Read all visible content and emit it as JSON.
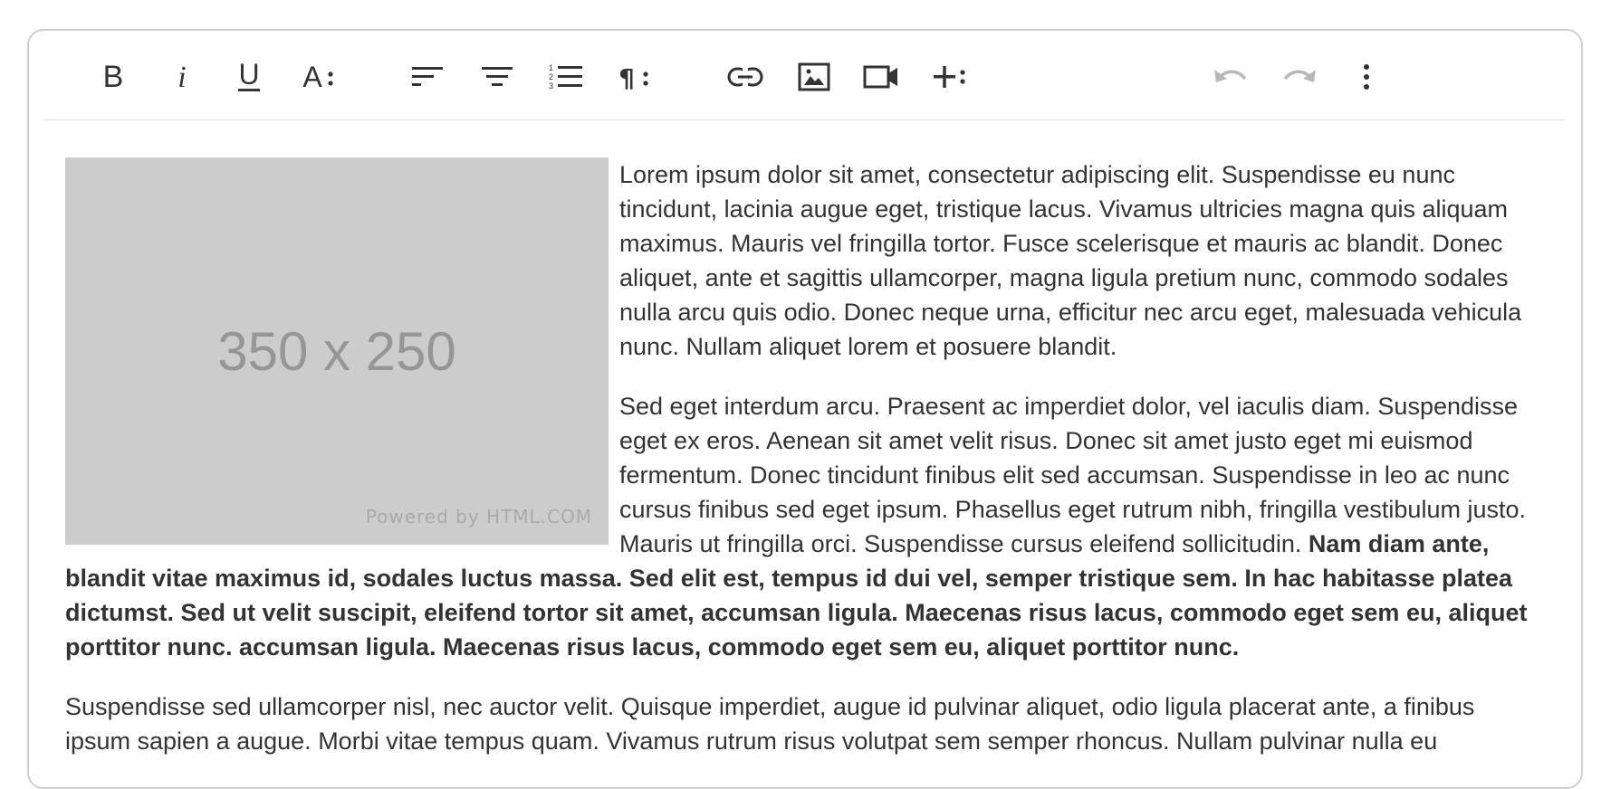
{
  "toolbar": {
    "groups": [
      {
        "name": "text-format",
        "items": [
          "bold",
          "italic",
          "underline",
          "text-style-more"
        ]
      },
      {
        "name": "paragraph-format",
        "items": [
          "align-left",
          "align-center",
          "ordered-list",
          "paragraph-more"
        ]
      },
      {
        "name": "insert",
        "items": [
          "link",
          "image",
          "video",
          "insert-more"
        ]
      },
      {
        "name": "history",
        "items": [
          "undo",
          "redo",
          "more-options"
        ]
      }
    ],
    "undo_enabled": false,
    "redo_enabled": false,
    "colors": {
      "icon": "#333333",
      "icon_disabled": "#b8b8b8"
    }
  },
  "image": {
    "label": "350 x 250",
    "powered_by": "Powered by HTML.COM",
    "background": "#cccccc"
  },
  "content": {
    "paragraph1": "Lorem ipsum dolor sit amet, consectetur adipiscing elit. Suspendisse eu nunc tincidunt, lacinia augue eget, tristique lacus. Vivamus ultricies magna quis aliquam maximus. Mauris vel fringilla tortor. Fusce scelerisque et mauris ac blandit. Donec aliquet, ante et sagittis ullamcorper, magna ligula pretium nunc, commodo sodales nulla arcu quis odio. Donec neque urna, efficitur nec arcu eget, malesuada vehicula nunc. Nullam aliquet lorem et posuere blandit.",
    "paragraph2_normal": "Sed eget interdum arcu. Praesent ac imperdiet dolor, vel iaculis diam. Suspendisse eget ex eros. Aenean sit amet velit risus. Donec sit amet justo eget mi euismod fermentum. Donec tincidunt finibus elit sed accumsan. Suspendisse in leo ac nunc cursus finibus sed eget ipsum. Phasellus eget rutrum nibh, fringilla vestibulum justo.  Mauris ut fringilla orci. Suspendisse cursus eleifend sollicitudin. ",
    "paragraph2_bold": "Nam diam ante, blandit vitae maximus id, sodales luctus massa. Sed elit est, tempus id dui vel, semper tristique sem. In hac habitasse platea dictumst. Sed ut velit suscipit, eleifend tortor sit amet, accumsan ligula. Maecenas risus lacus, commodo eget sem eu, aliquet porttitor nunc. accumsan ligula. Maecenas risus lacus, commodo eget sem eu, aliquet porttitor nunc.",
    "paragraph3": "Suspendisse sed ullamcorper nisl, nec auctor velit. Quisque imperdiet, augue id pulvinar aliquet, odio ligula placerat ante, a finibus ipsum sapien a augue. Morbi vitae tempus quam. Vivamus rutrum risus volutpat sem semper rhoncus. Nullam pulvinar nulla eu"
  }
}
